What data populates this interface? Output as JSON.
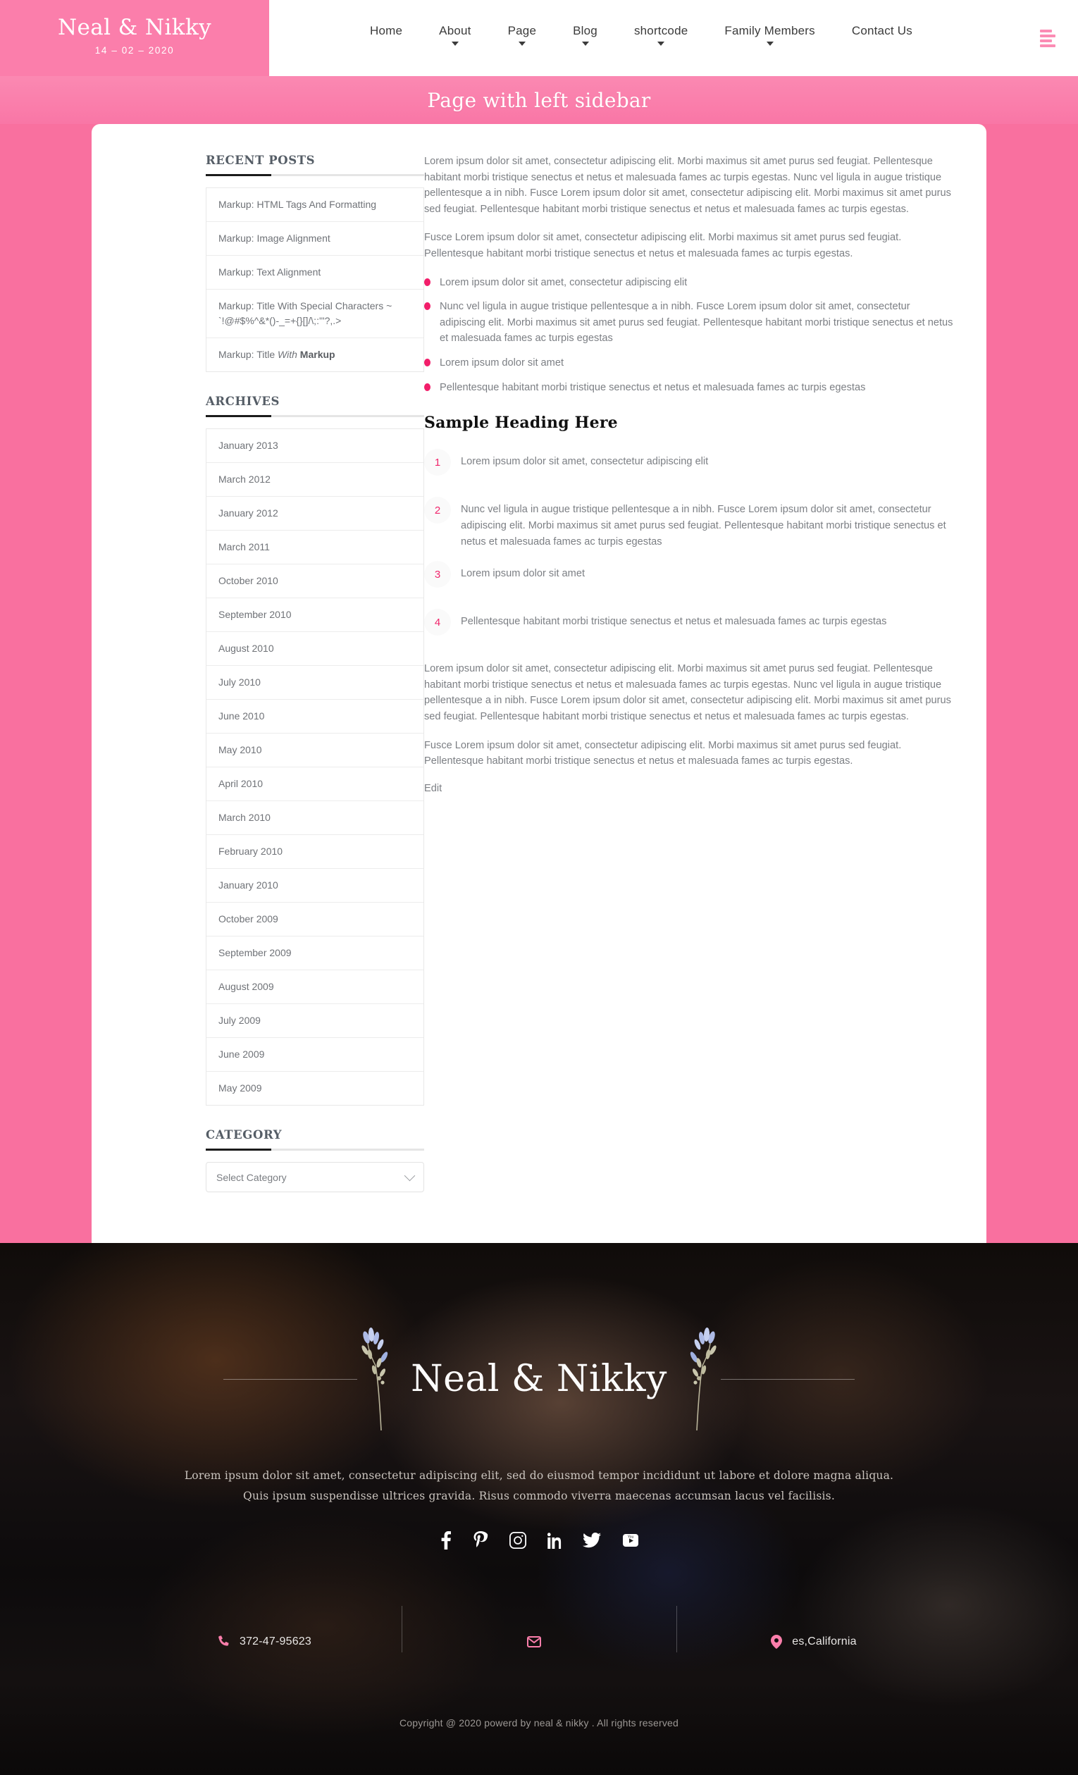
{
  "header": {
    "brand_name": "Neal & Nikky",
    "brand_date": "14 – 02 – 2020",
    "nav": [
      {
        "label": "Home",
        "has_caret": false
      },
      {
        "label": "About",
        "has_caret": true
      },
      {
        "label": "Page",
        "has_caret": true
      },
      {
        "label": "Blog",
        "has_caret": true
      },
      {
        "label": "shortcode",
        "has_caret": true
      },
      {
        "label": "Family Members",
        "has_caret": true
      },
      {
        "label": "Contact Us",
        "has_caret": false
      }
    ],
    "menu_icon": "hamburger-icon"
  },
  "banner": {
    "title": "Page with left sidebar"
  },
  "sidebar": {
    "recent_posts": {
      "title": "RECENT POSTS",
      "items": [
        {
          "text": "Markup: HTML Tags And Formatting"
        },
        {
          "text": "Markup: Image Alignment"
        },
        {
          "text": "Markup: Text Alignment"
        },
        {
          "text": "Markup: Title With Special Characters ~ `!@#$%^&*()-_=+{}[]/\\;:'\"?,.>"
        },
        {
          "text_pre": "Markup: Title ",
          "text_italic": "With",
          "text_bold": " Markup"
        }
      ]
    },
    "archives": {
      "title": "ARCHIVES",
      "items": [
        "January 2013",
        "March 2012",
        "January 2012",
        "March 2011",
        "October 2010",
        "September 2010",
        "August 2010",
        "July 2010",
        "June 2010",
        "May 2010",
        "April 2010",
        "March 2010",
        "February 2010",
        "January 2010",
        "October 2009",
        "September 2009",
        "August 2009",
        "July 2009",
        "June 2009",
        "May 2009"
      ]
    },
    "category": {
      "title": "CATEGORY",
      "selected": "Select Category",
      "icon": "chevron-down-icon"
    }
  },
  "main": {
    "paragraph_1": "Lorem ipsum dolor sit amet, consectetur adipiscing elit. Morbi maximus sit amet purus sed feugiat. Pellentesque habitant morbi tristique senectus et netus et malesuada fames ac turpis egestas. Nunc vel ligula in augue tristique pellentesque a in nibh. Fusce Lorem ipsum dolor sit amet, consectetur adipiscing elit. Morbi maximus sit amet purus sed feugiat. Pellentesque habitant morbi tristique senectus et netus et malesuada fames ac turpis egestas.",
    "paragraph_2": "Fusce Lorem ipsum dolor sit amet, consectetur adipiscing elit. Morbi maximus sit amet purus sed feugiat. Pellentesque habitant morbi tristique senectus et netus et malesuada fames ac turpis egestas.",
    "bullets": [
      "Lorem ipsum dolor sit amet, consectetur adipiscing elit",
      "Nunc vel ligula in augue tristique pellentesque a in nibh. Fusce Lorem ipsum dolor sit amet, consectetur adipiscing elit. Morbi maximus sit amet purus sed feugiat. Pellentesque habitant morbi tristique senectus et netus et malesuada fames ac turpis egestas",
      "Lorem ipsum dolor sit amet",
      "Pellentesque habitant morbi tristique senectus et netus et malesuada fames ac turpis egestas"
    ],
    "sample_heading": "Sample Heading Here",
    "numbered": [
      {
        "n": "1",
        "text": "Lorem ipsum dolor sit amet, consectetur adipiscing elit"
      },
      {
        "n": "2",
        "text": "Nunc vel ligula in augue tristique pellentesque a in nibh. Fusce Lorem ipsum dolor sit amet, consectetur adipiscing elit. Morbi maximus sit amet purus sed feugiat. Pellentesque habitant morbi tristique senectus et netus et malesuada fames ac turpis egestas"
      },
      {
        "n": "3",
        "text": "Lorem ipsum dolor sit amet"
      },
      {
        "n": "4",
        "text": "Pellentesque habitant morbi tristique senectus et netus et malesuada fames ac turpis egestas"
      }
    ],
    "paragraph_3": "Lorem ipsum dolor sit amet, consectetur adipiscing elit. Morbi maximus sit amet purus sed feugiat. Pellentesque habitant morbi tristique senectus et netus et malesuada fames ac turpis egestas. Nunc vel ligula in augue tristique pellentesque a in nibh. Fusce Lorem ipsum dolor sit amet, consectetur adipiscing elit. Morbi maximus sit amet purus sed feugiat. Pellentesque habitant morbi tristique senectus et netus et malesuada fames ac turpis egestas.",
    "paragraph_4": "Fusce Lorem ipsum dolor sit amet, consectetur adipiscing elit. Morbi maximus sit amet purus sed feugiat. Pellentesque habitant morbi tristique senectus et netus et malesuada fames ac turpis egestas.",
    "edit_label": "Edit"
  },
  "footer": {
    "logo": "Neal & Nikky",
    "description_line_1": "Lorem ipsum dolor sit amet, consectetur adipiscing elit, sed do eiusmod tempor incididunt ut labore et dolore magna aliqua.",
    "description_line_2": "Quis ipsum suspendisse ultrices gravida. Risus commodo viverra maecenas accumsan lacus vel facilisis.",
    "socials": [
      {
        "name": "facebook-icon"
      },
      {
        "name": "pinterest-icon"
      },
      {
        "name": "instagram-icon"
      },
      {
        "name": "linkedin-icon"
      },
      {
        "name": "twitter-icon"
      },
      {
        "name": "youtube-icon"
      }
    ],
    "contacts": [
      {
        "icon": "phone-icon",
        "text": "372-47-95623"
      },
      {
        "icon": "mail-icon",
        "text": ""
      },
      {
        "icon": "location-icon",
        "text": "es,California"
      }
    ],
    "copyright": "Copyright @ 2020 powerd by neal & nikky . All rights reserved"
  },
  "colors": {
    "brand_pink": "#fb7eab",
    "banner_pink": "#f9709f",
    "accent_magenta": "#f21e6a",
    "text_grey": "#7c7f84",
    "footer_dark": "#100c0a"
  }
}
